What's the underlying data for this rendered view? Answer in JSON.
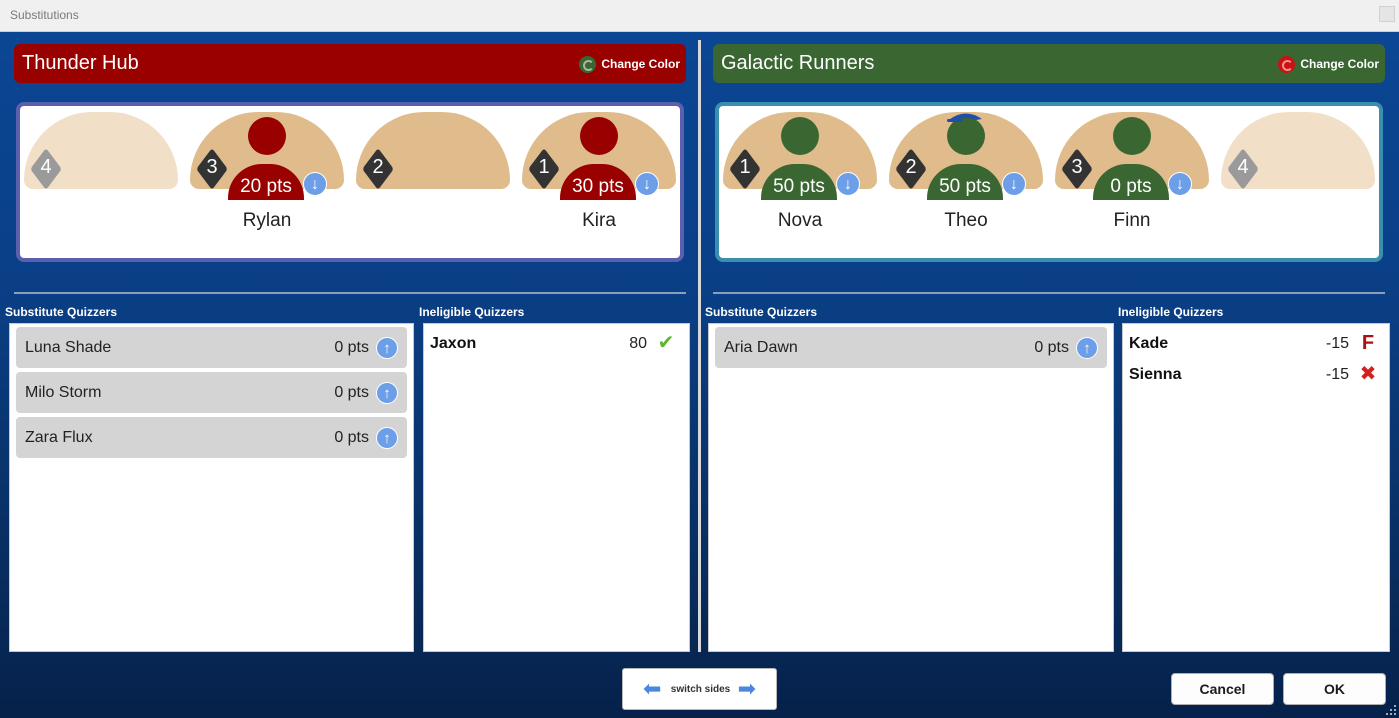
{
  "window": {
    "title": "Substitutions"
  },
  "colors": {
    "team1": "#990000",
    "team2": "#3a6632",
    "seat_empty": "#f1dfc8",
    "seat_filled": "#e0bc8d",
    "accent_blue": "#6d9ee8"
  },
  "team1": {
    "name": "Thunder Hub",
    "change_color_label": "Change Color",
    "seats": [
      {
        "num": "4",
        "empty": true
      },
      {
        "num": "3",
        "name": "Rylan",
        "pts": "20 pts"
      },
      {
        "num": "2",
        "empty": true
      },
      {
        "num": "1",
        "name": "Kira",
        "pts": "30 pts"
      }
    ],
    "substitute_label": "Substitute Quizzers",
    "substitutes": [
      {
        "name": "Luna Shade",
        "pts": "0 pts"
      },
      {
        "name": "Milo Storm",
        "pts": "0 pts"
      },
      {
        "name": "Zara Flux",
        "pts": "0 pts"
      }
    ],
    "ineligible_label": "Ineligible Quizzers",
    "ineligible": [
      {
        "name": "Jaxon",
        "pts": "80",
        "status": "check-icon"
      }
    ]
  },
  "team2": {
    "name": "Galactic Runners",
    "change_color_label": "Change Color",
    "seats": [
      {
        "num": "1",
        "name": "Nova",
        "pts": "50 pts"
      },
      {
        "num": "2",
        "name": "Theo",
        "pts": "50 pts",
        "captain": true
      },
      {
        "num": "3",
        "name": "Finn",
        "pts": "0 pts"
      },
      {
        "num": "4",
        "empty": true
      }
    ],
    "substitute_label": "Substitute Quizzers",
    "substitutes": [
      {
        "name": "Aria Dawn",
        "pts": "0 pts"
      }
    ],
    "ineligible_label": "Ineligible Quizzers",
    "ineligible": [
      {
        "name": "Kade",
        "pts": "-15",
        "status": "F"
      },
      {
        "name": "Sienna",
        "pts": "-15",
        "status": "x-icon"
      }
    ]
  },
  "footer": {
    "switch_label": "switch sides",
    "cancel_label": "Cancel",
    "ok_label": "OK"
  }
}
